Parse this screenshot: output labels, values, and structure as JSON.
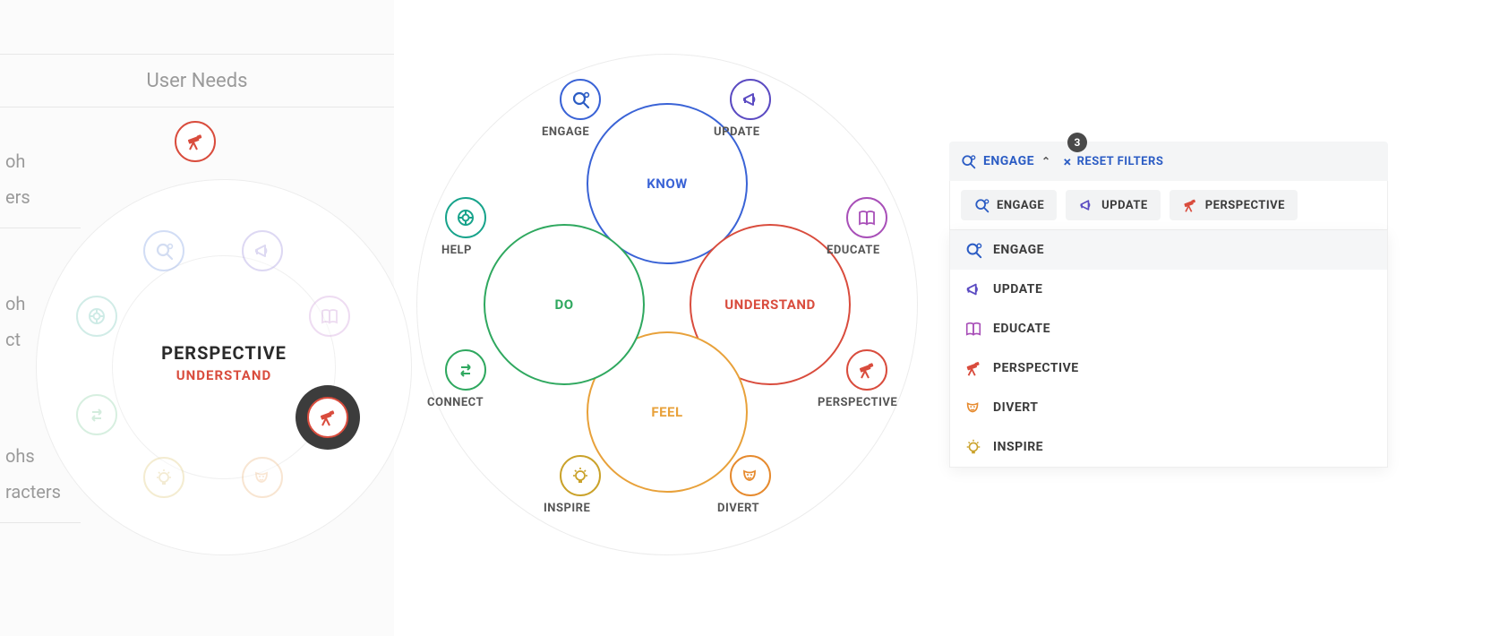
{
  "leftPanel": {
    "header": "User Needs",
    "sideRows": [
      "oh",
      "ers",
      "oh",
      "ct",
      "ohs",
      "racters"
    ],
    "center": {
      "need": "PERSPECTIVE",
      "quad": "UNDERSTAND"
    }
  },
  "needs": {
    "engage": {
      "label": "ENGAGE",
      "colorClass": "c-blue"
    },
    "update": {
      "label": "UPDATE",
      "colorClass": "c-indigo"
    },
    "educate": {
      "label": "EDUCATE",
      "colorClass": "c-purple"
    },
    "perspective": {
      "label": "PERSPECTIVE",
      "colorClass": "c-red"
    },
    "divert": {
      "label": "DIVERT",
      "colorClass": "c-orange"
    },
    "inspire": {
      "label": "INSPIRE",
      "colorClass": "c-amber"
    },
    "connect": {
      "label": "CONNECT",
      "colorClass": "c-green"
    },
    "help": {
      "label": "HELP",
      "colorClass": "c-teal"
    }
  },
  "quads": {
    "know": {
      "label": "KNOW",
      "borderClass": "b-blue"
    },
    "understand": {
      "label": "UNDERSTAND",
      "borderClass": "b-red"
    },
    "feel": {
      "label": "FEEL",
      "borderClass": "b-orange"
    },
    "do": {
      "label": "DO",
      "borderClass": "b-green"
    }
  },
  "filters": {
    "active": "ENGAGE",
    "badge": "3",
    "reset": "RESET FILTERS",
    "chips": [
      "engage",
      "update",
      "perspective"
    ],
    "menu": [
      "engage",
      "update",
      "educate",
      "perspective",
      "divert",
      "inspire"
    ],
    "selected": "engage"
  }
}
